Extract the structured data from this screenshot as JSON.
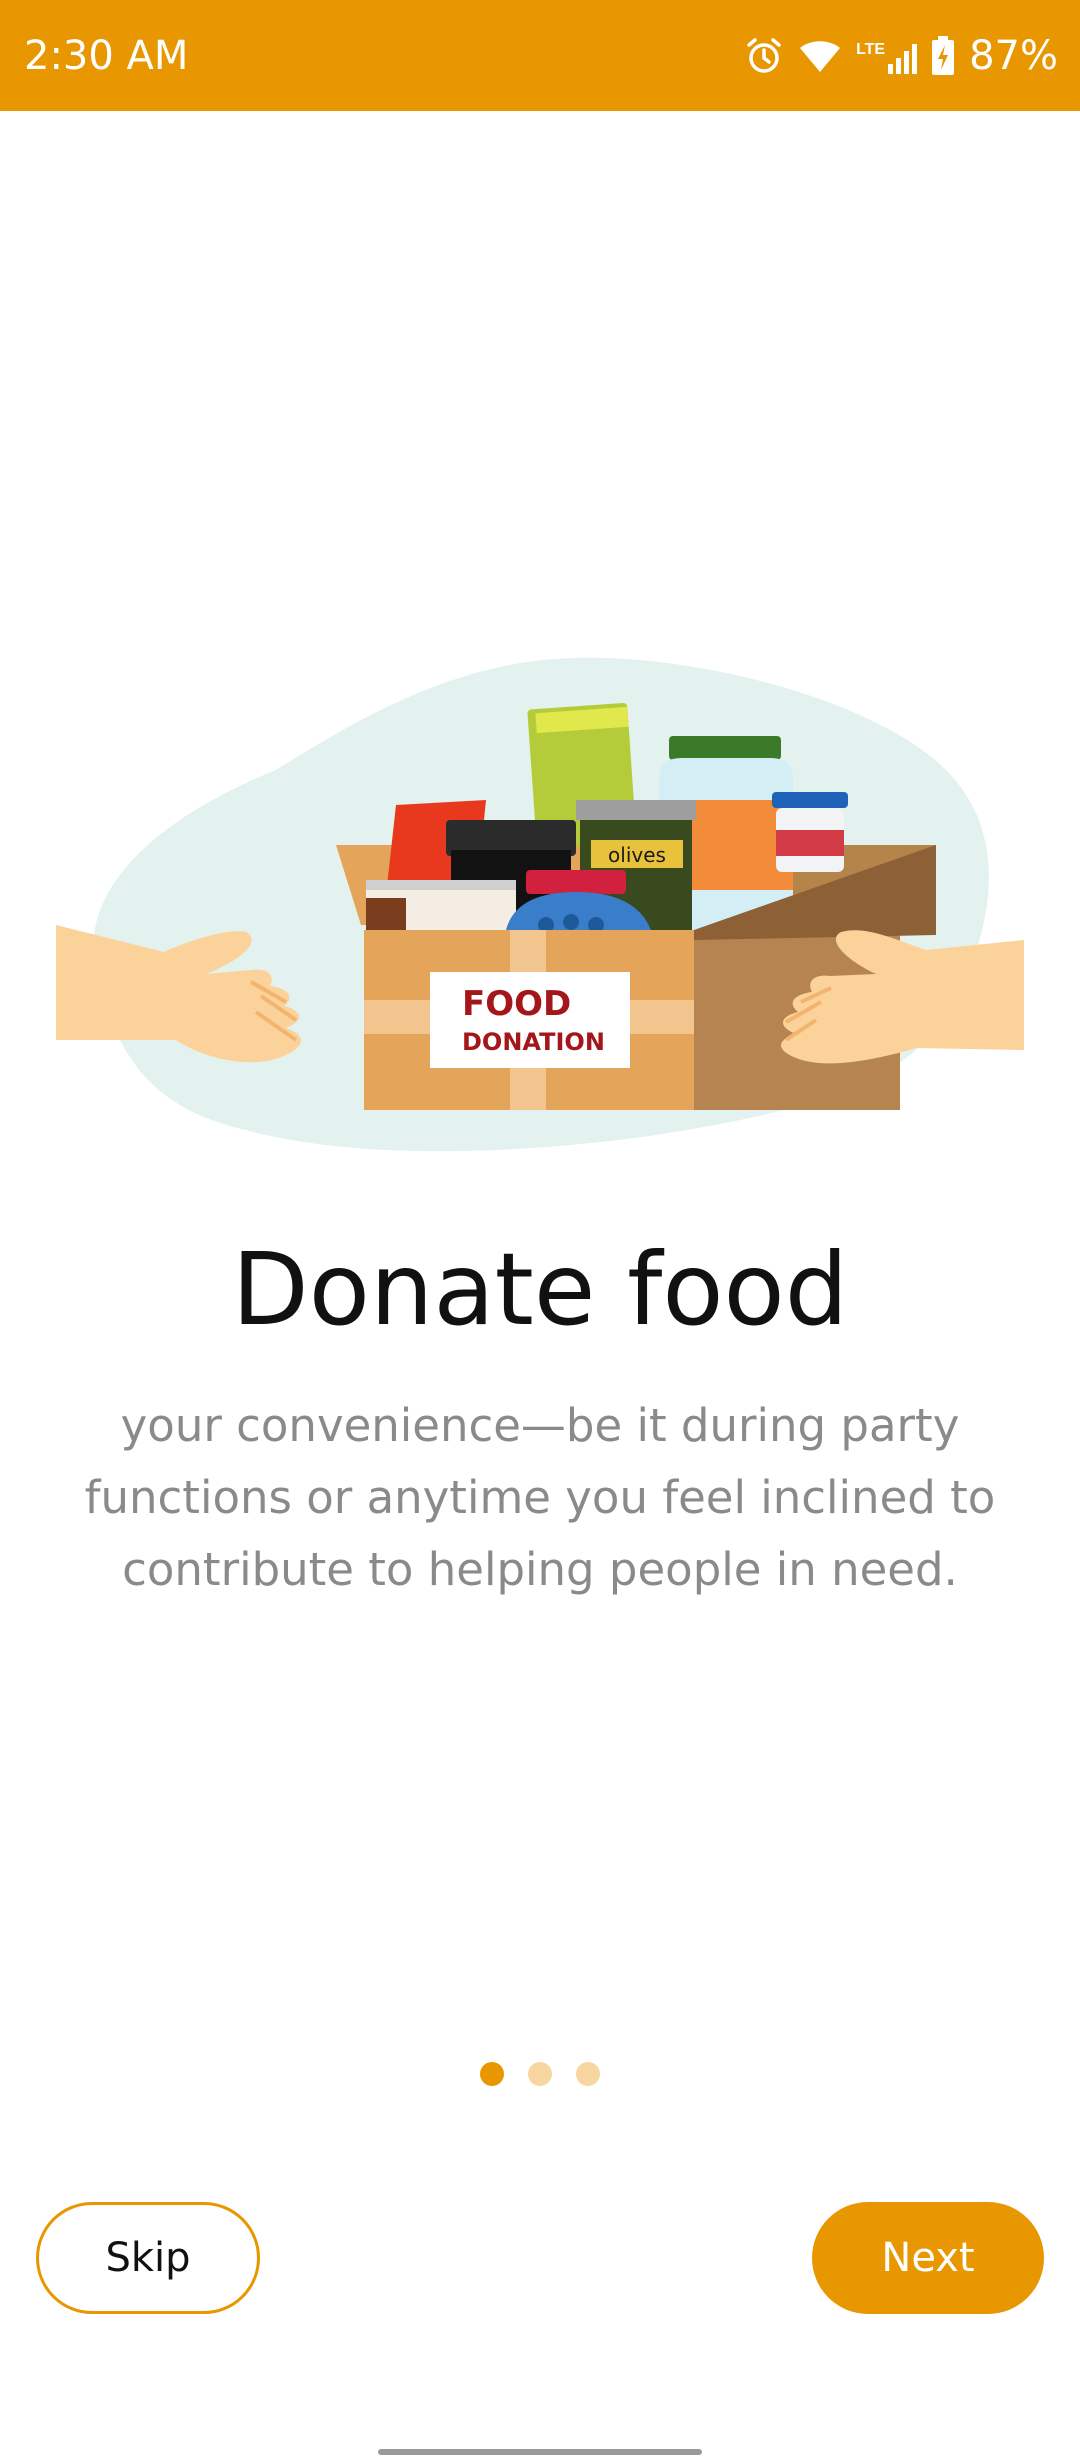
{
  "status_bar": {
    "time": "2:30 AM",
    "network_label": "LTE",
    "battery_percent": "87%",
    "icons": [
      "alarm-icon",
      "wifi-icon",
      "lte-signal-icon",
      "battery-charging-icon"
    ]
  },
  "illustration": {
    "box_label_line1": "FOOD",
    "box_label_line2": "DONATION",
    "jar_label": "olives"
  },
  "onboarding": {
    "title": "Donate food",
    "description": "your convenience—be it during party functions or anytime you feel inclined to contribute to helping people in need.",
    "page_count": 3,
    "active_page": 1
  },
  "buttons": {
    "skip_label": "Skip",
    "next_label": "Next"
  },
  "colors": {
    "accent": "#E99700",
    "dot_inactive": "#F7D6A0",
    "description_text": "#8a8a8a",
    "title_text": "#111111"
  }
}
